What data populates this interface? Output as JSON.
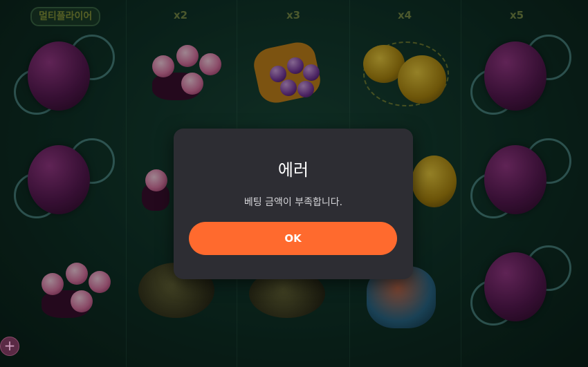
{
  "multipliers": {
    "m1": "멀티플라이어",
    "m2": "x2",
    "m3": "x3",
    "m4": "x4",
    "m5": "x5"
  },
  "dialog": {
    "title": "에러",
    "message": "베팅 금액이 부족합니다.",
    "ok_label": "OK"
  },
  "bottom": {
    "add_icon": "+"
  },
  "colors": {
    "dialog_bg": "#2d2d33",
    "ok_button": "#ff6a2e",
    "board_bg": "#0f3328"
  }
}
